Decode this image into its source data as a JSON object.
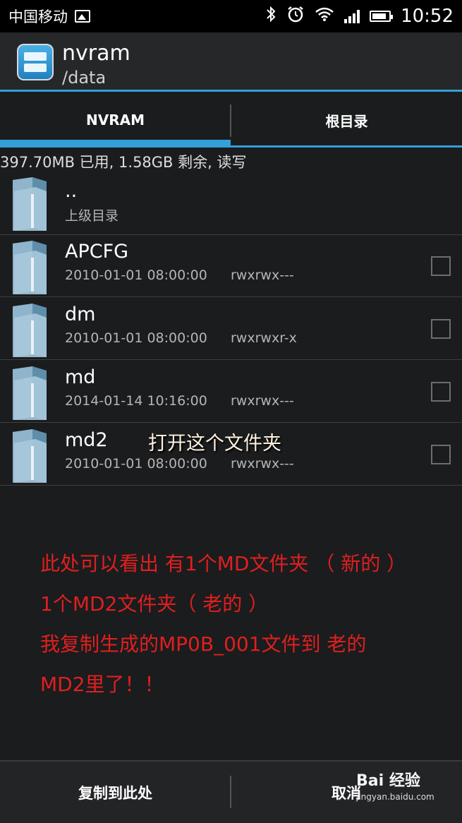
{
  "status_bar": {
    "carrier": "中国移动",
    "time": "10:52"
  },
  "app_bar": {
    "title": "nvram",
    "path": "/data"
  },
  "tabs": [
    {
      "label": "NVRAM",
      "selected": true
    },
    {
      "label": "根目录",
      "selected": false
    }
  ],
  "storage_info": "397.70MB 已用, 1.58GB 剩余, 读写",
  "files": [
    {
      "name": "..",
      "subtitle": "上级目录"
    },
    {
      "name": "APCFG",
      "date": "2010-01-01 08:00:00",
      "perms": "rwxrwx---",
      "checked": false
    },
    {
      "name": "dm",
      "date": "2010-01-01 08:00:00",
      "perms": "rwxrwxr-x",
      "checked": false
    },
    {
      "name": "md",
      "date": "2014-01-14 10:16:00",
      "perms": "rwxrwx---",
      "checked": false
    },
    {
      "name": "md2",
      "date": "2010-01-01 08:00:00",
      "perms": "rwxrwx---",
      "checked": false
    }
  ],
  "overlay_note": "打开这个文件夹",
  "annotation_lines": [
    "此处可以看出 有1个MD文件夹 （ 新的 ）",
    "1个MD2文件夹（ 老的 ）",
    "我复制生成的MP0B_001文件到 老的",
    "MD2里了！！"
  ],
  "bottom_bar": {
    "copy_here": "复制到此处",
    "cancel": "取消"
  },
  "watermark": {
    "brand": "Bai  经验",
    "url": "jingyan.baidu.com"
  },
  "colors": {
    "accent": "#33a0d8",
    "annotation": "#e01f1f",
    "background": "#1b1c1e"
  }
}
